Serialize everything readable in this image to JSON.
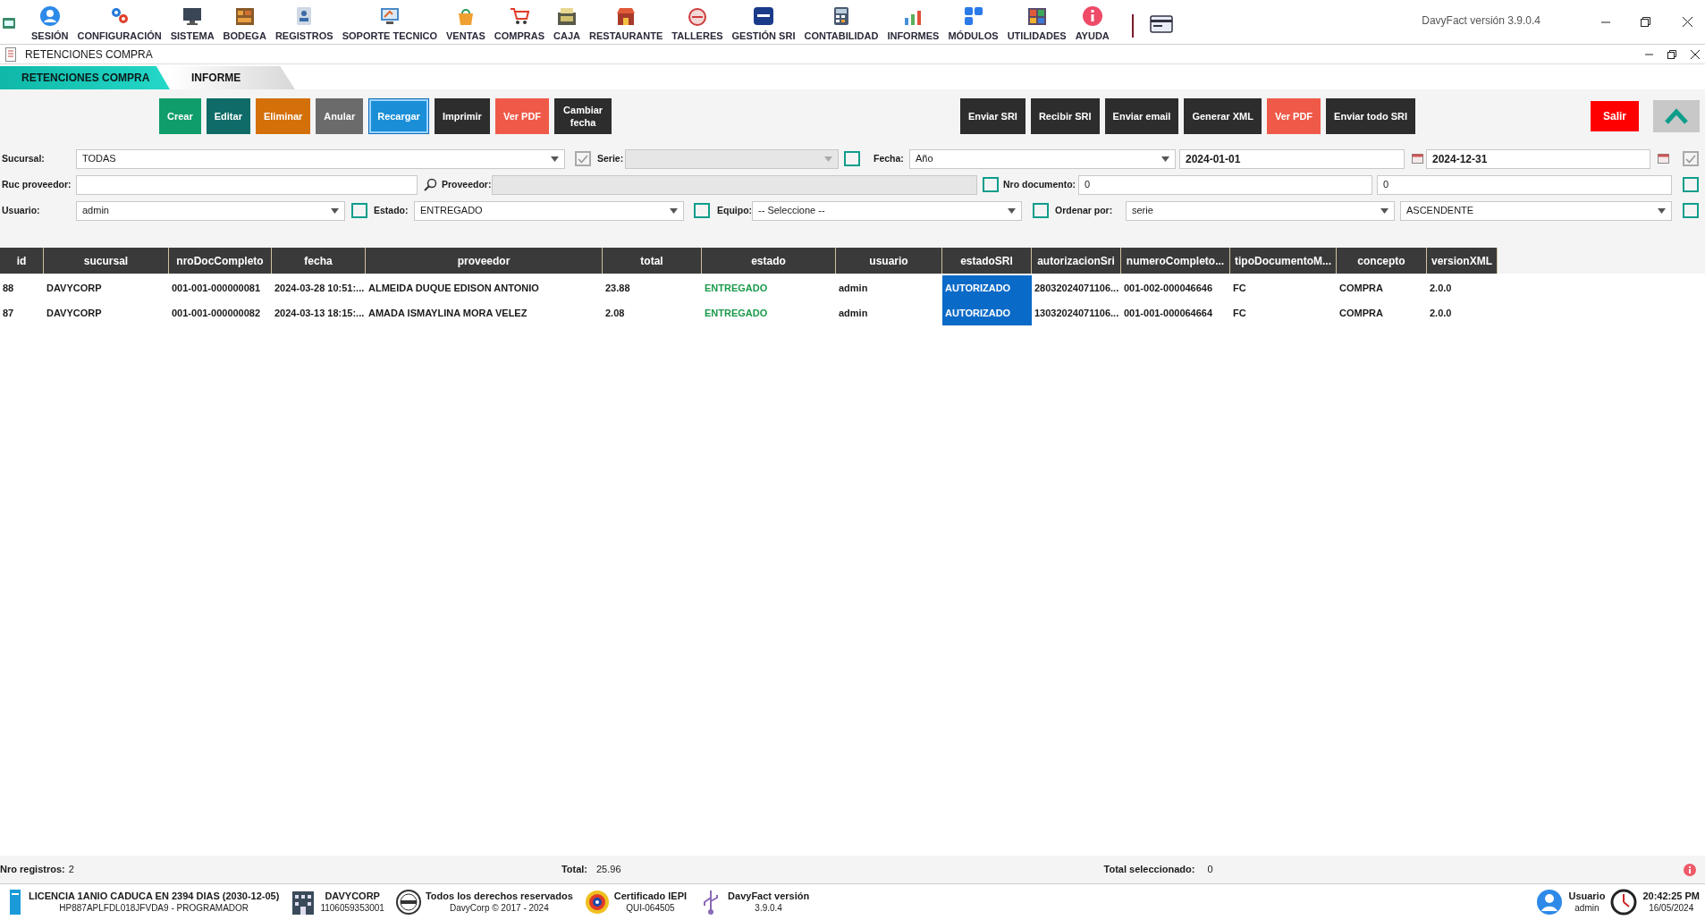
{
  "app_title": "DavyFact versión 3.9.0.4",
  "menu": [
    {
      "label": "SESIÓN"
    },
    {
      "label": "CONFIGURACIÓN"
    },
    {
      "label": "SISTEMA"
    },
    {
      "label": "BODEGA"
    },
    {
      "label": "REGISTROS"
    },
    {
      "label": "SOPORTE TECNICO"
    },
    {
      "label": "VENTAS"
    },
    {
      "label": "COMPRAS"
    },
    {
      "label": "CAJA"
    },
    {
      "label": "RESTAURANTE"
    },
    {
      "label": "TALLERES"
    },
    {
      "label": "GESTIÓN SRI"
    },
    {
      "label": "CONTABILIDAD"
    },
    {
      "label": "INFORMES"
    },
    {
      "label": "MÓDULOS"
    },
    {
      "label": "UTILIDADES"
    },
    {
      "label": "AYUDA"
    }
  ],
  "window_title": "RETENCIONES COMPRA",
  "tabs": [
    {
      "label": "RETENCIONES COMPRA",
      "selected": true
    },
    {
      "label": "INFORME",
      "selected": false
    }
  ],
  "buttons_left": [
    {
      "label": "Crear",
      "color": "#0f9d6b",
      "focused": false
    },
    {
      "label": "Editar",
      "color": "#0f6b68",
      "focused": false
    },
    {
      "label": "Eliminar",
      "color": "#d4700a",
      "focused": false
    },
    {
      "label": "Anular",
      "color": "#6b6b6b",
      "focused": false
    },
    {
      "label": "Recargar",
      "color": "#1a8fd8",
      "focused": true
    },
    {
      "label": "Imprimir",
      "color": "#2d2d2d",
      "focused": false
    },
    {
      "label": "Ver PDF",
      "color": "#ef5a48",
      "focused": false
    },
    {
      "label": "Cambiar fecha",
      "color": "#2d2d2d",
      "focused": false
    }
  ],
  "buttons_right": [
    {
      "label": "Enviar SRI",
      "color": "#2d2d2d"
    },
    {
      "label": "Recibir SRI",
      "color": "#2d2d2d"
    },
    {
      "label": "Enviar email",
      "color": "#2d2d2d"
    },
    {
      "label": "Generar XML",
      "color": "#2d2d2d"
    },
    {
      "label": "Ver PDF",
      "color": "#ef5a48"
    },
    {
      "label": "Enviar todo SRI",
      "color": "#2d2d2d"
    }
  ],
  "exit_button": {
    "label": "Salir"
  },
  "filters": [
    [
      {
        "kind": "label",
        "text": "Sucursal:"
      },
      {
        "kind": "select",
        "value": "TODAS",
        "disabled": false
      },
      {
        "kind": "checkbox",
        "checked": true,
        "disabled": true
      },
      {
        "kind": "label",
        "text": "Serie:"
      },
      {
        "kind": "select",
        "disabled": true
      },
      {
        "kind": "checkbox",
        "checked": false,
        "disabled": false
      },
      {
        "kind": "label",
        "text": "Fecha:"
      },
      {
        "kind": "select",
        "value": "Año",
        "disabled": false
      },
      {
        "kind": "date",
        "value": "2024-01-01"
      },
      {
        "kind": "date",
        "value": "2024-12-31"
      },
      {
        "kind": "checkbox",
        "checked": true,
        "disabled": true
      }
    ],
    [
      {
        "kind": "label",
        "text": "Ruc proveedor:"
      },
      {
        "kind": "input",
        "disabled": false
      },
      {
        "kind": "search"
      },
      {
        "kind": "label",
        "text": "Proveedor:"
      },
      {
        "kind": "input",
        "disabled": true
      },
      {
        "kind": "checkbox",
        "checked": false,
        "disabled": false
      },
      {
        "kind": "label",
        "text": "Nro documento:"
      },
      {
        "kind": "input",
        "value": "0",
        "disabled": false
      },
      {
        "kind": "input",
        "value": "0",
        "disabled": false
      },
      {
        "kind": "checkbox",
        "checked": false,
        "disabled": false
      }
    ],
    [
      {
        "kind": "label",
        "text": "Usuario:"
      },
      {
        "kind": "select",
        "value": "admin",
        "disabled": false
      },
      {
        "kind": "checkbox",
        "checked": false,
        "disabled": false
      },
      {
        "kind": "label",
        "text": "Estado:"
      },
      {
        "kind": "select",
        "value": "ENTREGADO",
        "disabled": false
      },
      {
        "kind": "checkbox",
        "checked": false,
        "disabled": false
      },
      {
        "kind": "label",
        "text": "Equipo:"
      },
      {
        "kind": "select",
        "value": "-- Seleccione --",
        "disabled": false
      },
      {
        "kind": "checkbox",
        "checked": false,
        "disabled": false
      },
      {
        "kind": "label",
        "text": "Ordenar por:"
      },
      {
        "kind": "select",
        "value": "serie",
        "disabled": false
      },
      {
        "kind": "select",
        "value": "ASCENDENTE",
        "disabled": false
      },
      {
        "kind": "checkbox",
        "checked": false,
        "disabled": false
      }
    ]
  ],
  "table": {
    "columns": [
      {
        "label": "id",
        "kind": "text"
      },
      {
        "label": "sucursal",
        "kind": "text"
      },
      {
        "label": "nroDocCompleto",
        "kind": "text"
      },
      {
        "label": "fecha",
        "kind": "text"
      },
      {
        "label": "proveedor",
        "kind": "text"
      },
      {
        "label": "total",
        "kind": "text"
      },
      {
        "label": "estado",
        "kind": "status"
      },
      {
        "label": "usuario",
        "kind": "text"
      },
      {
        "label": "estadoSRI",
        "kind": "sri"
      },
      {
        "label": "autorizacionSri",
        "kind": "text"
      },
      {
        "label": "numeroCompleto...",
        "kind": "text"
      },
      {
        "label": "tipoDocumentoM...",
        "kind": "text"
      },
      {
        "label": "concepto",
        "kind": "text"
      },
      {
        "label": "versionXML",
        "kind": "text"
      }
    ],
    "rows": [
      [
        "88",
        "DAVYCORP",
        "001-001-000000081",
        "2024-03-28 10:51:...",
        "ALMEIDA DUQUE EDISON ANTONIO",
        "23.88",
        "ENTREGADO",
        "admin",
        "AUTORIZADO",
        "28032024071106...",
        "001-002-000046646",
        "FC",
        "COMPRA",
        "2.0.0"
      ],
      [
        "87",
        "DAVYCORP",
        "001-001-000000082",
        "2024-03-13 18:15:...",
        "AMADA ISMAYLINA MORA VELEZ",
        "2.08",
        "ENTREGADO",
        "admin",
        "AUTORIZADO",
        "13032024071106...",
        "001-001-000064664",
        "FC",
        "COMPRA",
        "2.0.0"
      ]
    ]
  },
  "summary": {
    "records_label": "Nro registros:",
    "records": "2",
    "total_label": "Total:",
    "total": "25.96",
    "selected_label": "Total seleccionado:",
    "selected_total": "0"
  },
  "status_bar": [
    {
      "title": "LICENCIA 1ANIO CADUCA EN 2394 DIAS (2030-12-05)",
      "subtitle": "HP887APLFDL018JFVDA9 - PROGRAMADOR"
    },
    {
      "title": "DAVYCORP",
      "subtitle": "1106059353001"
    },
    {
      "title": "Todos los derechos reservados",
      "subtitle": "DavyCorp © 2017 - 2024"
    },
    {
      "title": "Certificado IEPI",
      "subtitle": "QUI-064505"
    },
    {
      "title": "DavyFact versión",
      "subtitle": "3.9.0.4"
    }
  ],
  "status_right": [
    {
      "title": "Usuario",
      "subtitle": "admin"
    },
    {
      "title": "20:42:25 PM",
      "subtitle": "16/05/2024"
    }
  ]
}
